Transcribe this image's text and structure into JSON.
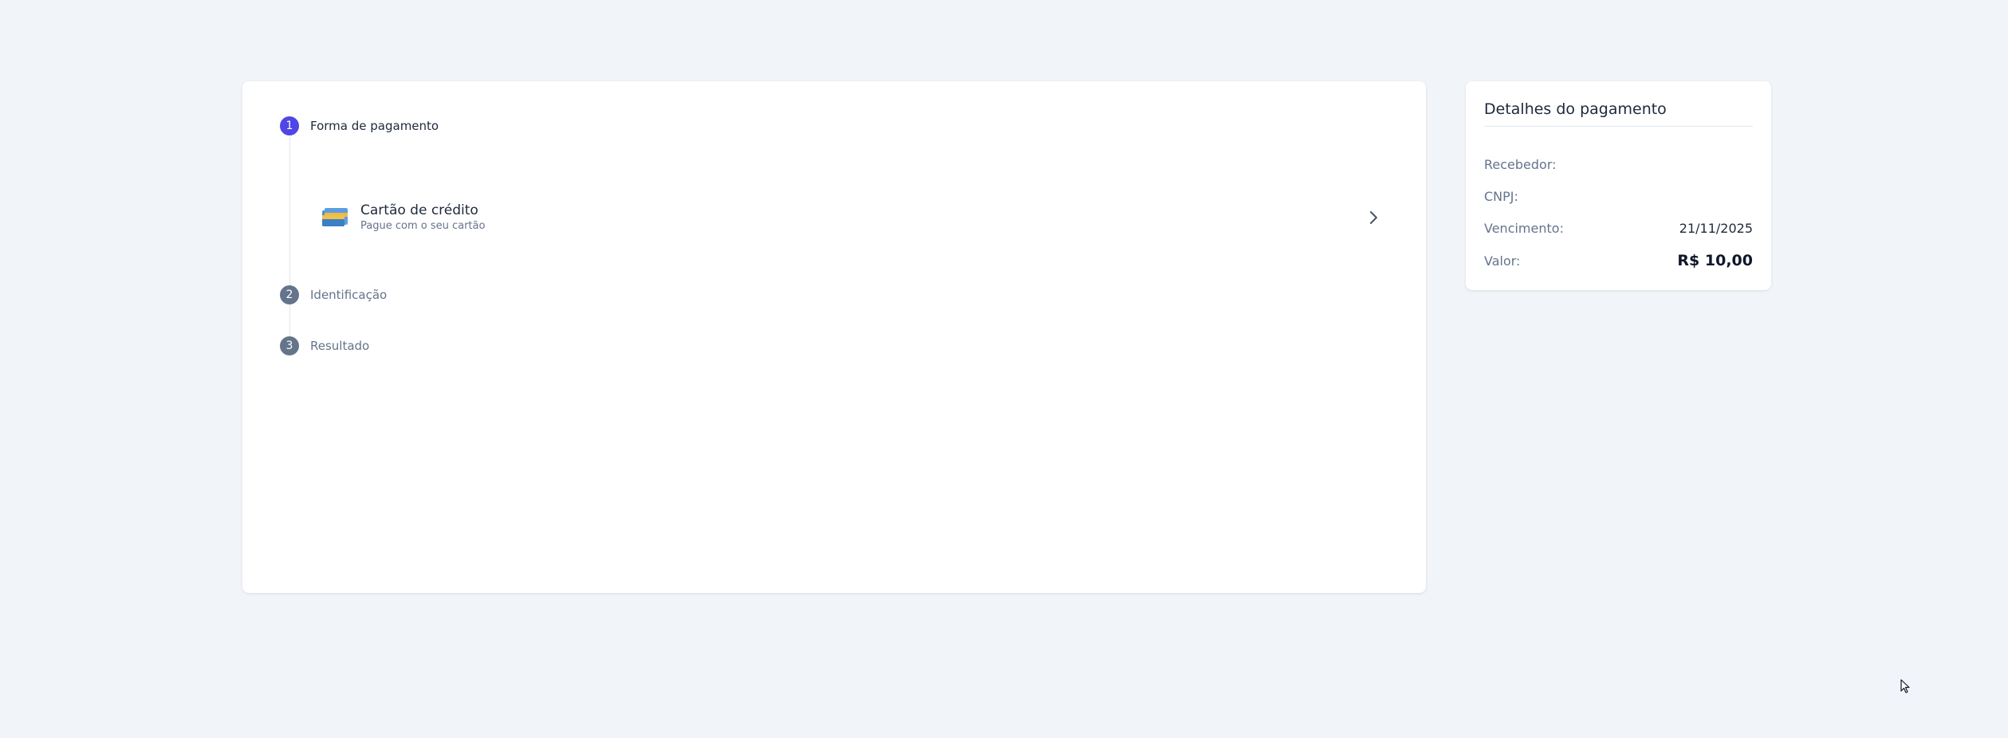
{
  "steps": [
    {
      "number": "1",
      "label": "Forma de pagamento",
      "state": "active"
    },
    {
      "number": "2",
      "label": "Identificação",
      "state": "inactive"
    },
    {
      "number": "3",
      "label": "Resultado",
      "state": "inactive"
    }
  ],
  "payment_methods": [
    {
      "title": "Cartão de crédito",
      "subtitle": "Pague com o seu cartão",
      "icon": "credit-card-icon"
    }
  ],
  "details": {
    "title": "Detalhes do pagamento",
    "recebedor_label": "Recebedor:",
    "recebedor_value": "",
    "cnpj_label": "CNPJ:",
    "cnpj_value": "",
    "vencimento_label": "Vencimento:",
    "vencimento_value": "21/11/2025",
    "valor_label": "Valor:",
    "valor_value": "R$ 10,00"
  },
  "colors": {
    "background": "#f1f4f8",
    "accent": "#4f46e5",
    "inactive_step": "#64748b"
  }
}
